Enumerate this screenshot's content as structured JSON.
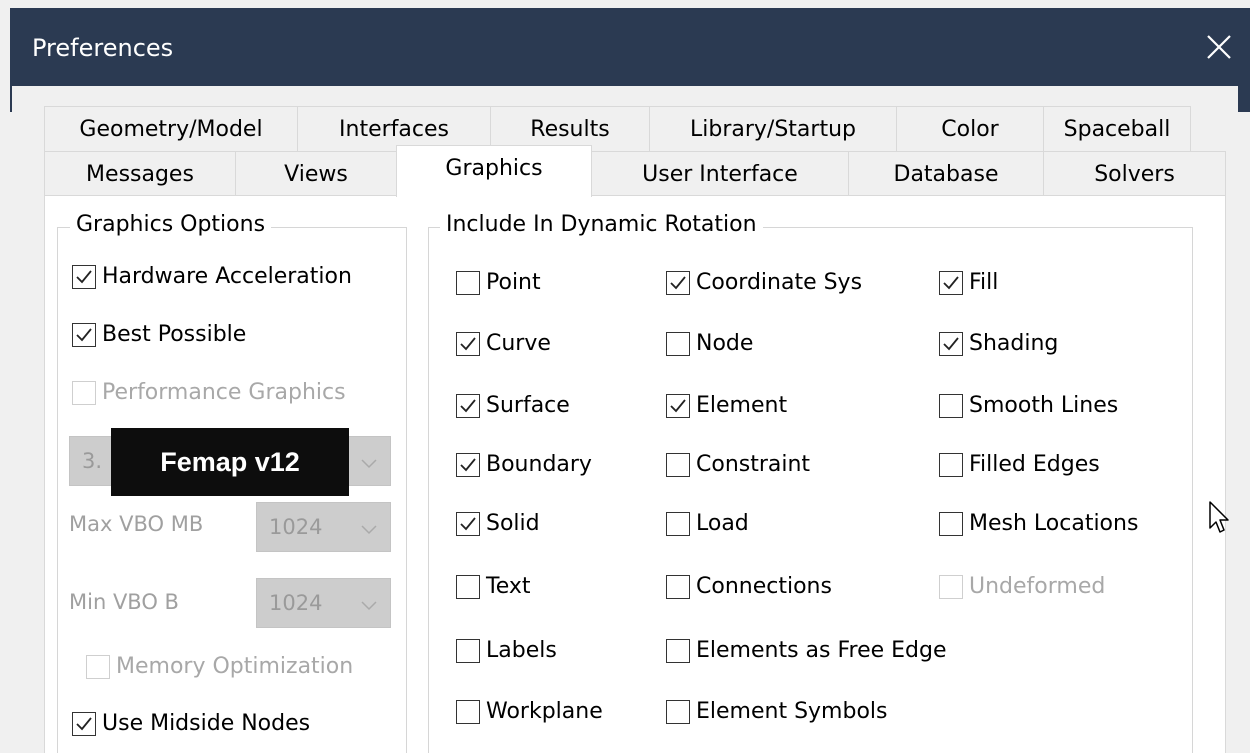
{
  "window": {
    "title": "Preferences"
  },
  "tabs_row1": [
    "Geometry/Model",
    "Interfaces",
    "Results",
    "Library/Startup",
    "Color",
    "Spaceball"
  ],
  "tabs_row2": [
    "Messages",
    "Views",
    "Graphics",
    "User Interface",
    "Database",
    "Solvers"
  ],
  "active_tab": "Graphics",
  "graphics_options": {
    "title": "Graphics Options",
    "hardware_acceleration": {
      "label": "Hardware Acceleration",
      "checked": true
    },
    "best_possible": {
      "label": "Best Possible",
      "checked": true
    },
    "performance_graphics": {
      "label": "Performance Graphics",
      "checked": false,
      "disabled": true
    },
    "version_combo_value": "3.",
    "max_vbo": {
      "label": "Max VBO MB",
      "value": "1024"
    },
    "min_vbo": {
      "label": "Min VBO B",
      "value": "1024"
    },
    "memory_optimization": {
      "label": "Memory Optimization",
      "checked": false,
      "disabled": true
    },
    "use_midside_nodes": {
      "label": "Use Midside Nodes",
      "checked": true
    }
  },
  "dynamic_rotation": {
    "title": "Include In Dynamic Rotation",
    "col1": [
      {
        "label": "Point",
        "checked": false
      },
      {
        "label": "Curve",
        "checked": true
      },
      {
        "label": "Surface",
        "checked": true
      },
      {
        "label": "Boundary",
        "checked": true
      },
      {
        "label": "Solid",
        "checked": true
      },
      {
        "label": "Text",
        "checked": false
      },
      {
        "label": "Labels",
        "checked": false
      },
      {
        "label": "Workplane",
        "checked": false
      }
    ],
    "col2": [
      {
        "label": "Coordinate Sys",
        "checked": true
      },
      {
        "label": "Node",
        "checked": false
      },
      {
        "label": "Element",
        "checked": true
      },
      {
        "label": "Constraint",
        "checked": false
      },
      {
        "label": "Load",
        "checked": false
      },
      {
        "label": "Connections",
        "checked": false
      },
      {
        "label": "Elements as Free Edge",
        "checked": false
      },
      {
        "label": "Element Symbols",
        "checked": false
      }
    ],
    "col3": [
      {
        "label": "Fill",
        "checked": true
      },
      {
        "label": "Shading",
        "checked": true
      },
      {
        "label": "Smooth Lines",
        "checked": false
      },
      {
        "label": "Filled Edges",
        "checked": false
      },
      {
        "label": "Mesh Locations",
        "checked": false
      },
      {
        "label": "Undeformed",
        "checked": false,
        "disabled": true
      }
    ]
  },
  "tooltip": "Femap v12",
  "colors": {
    "titlebar": "#2b3a52",
    "panel": "#ffffff",
    "tooltip_bg": "#0d0d0d"
  }
}
